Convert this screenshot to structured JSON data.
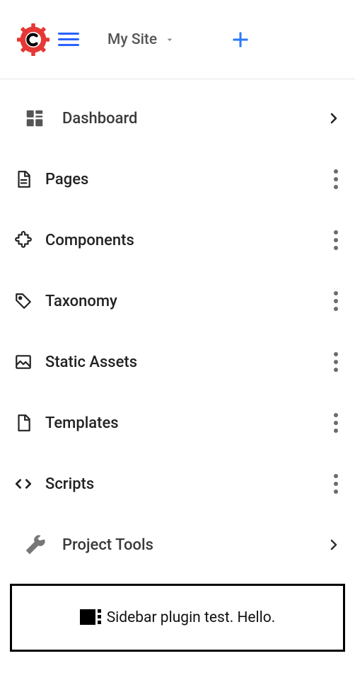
{
  "header": {
    "site_label": "My Site"
  },
  "nav": {
    "dashboard": "Dashboard",
    "pages": "Pages",
    "components": "Components",
    "taxonomy": "Taxonomy",
    "static_assets": "Static Assets",
    "templates": "Templates",
    "scripts": "Scripts",
    "project_tools": "Project Tools"
  },
  "plugin": {
    "text": "Sidebar plugin test. Hello."
  }
}
